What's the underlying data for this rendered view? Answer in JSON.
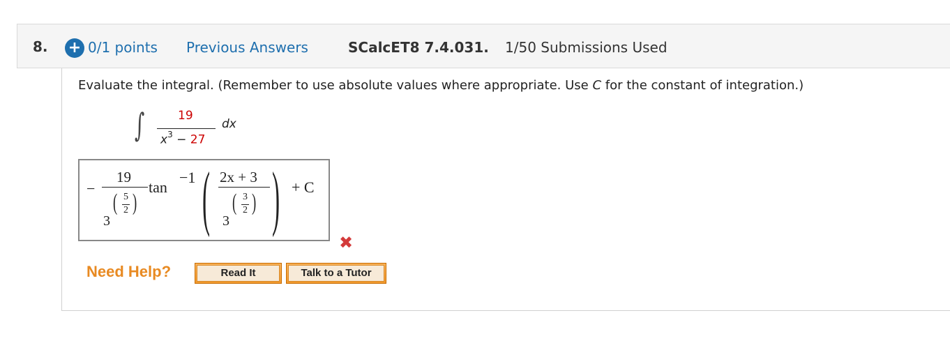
{
  "question": {
    "number": "8.",
    "plus_icon": "+",
    "points": "0/1 points",
    "previous_answers": "Previous Answers",
    "course_code": "SCalcET8 7.4.031.",
    "submissions": "1/50 Submissions Used"
  },
  "instructions": {
    "before": "Evaluate the integral. (Remember to use absolute values where appropriate. Use ",
    "var": "C",
    "after": " for the constant of integration.)"
  },
  "integral": {
    "sign": "∫",
    "numerator": "19",
    "den_x": "x",
    "den_exp": "3",
    "den_minus": " − ",
    "den_const": "27",
    "dx": "dx"
  },
  "answer": {
    "minus": "−",
    "coef_num": "19",
    "coef_base": "3",
    "coef_exp_num": "5",
    "coef_exp_den": "2",
    "tan": "tan",
    "tan_exp": "−1",
    "arg_num": "2x + 3",
    "arg_base": "3",
    "arg_exp_num": "3",
    "arg_exp_den": "2",
    "plus_c": "+ C",
    "status_icon": "✖",
    "status": "incorrect"
  },
  "help": {
    "label": "Need Help?",
    "read_it": "Read It",
    "talk_to_tutor": "Talk to a Tutor"
  },
  "colors": {
    "link_blue": "#1e6fae",
    "randomized_red": "#cc0000",
    "help_orange": "#e88a22",
    "wrong_red": "#d33a3a"
  }
}
